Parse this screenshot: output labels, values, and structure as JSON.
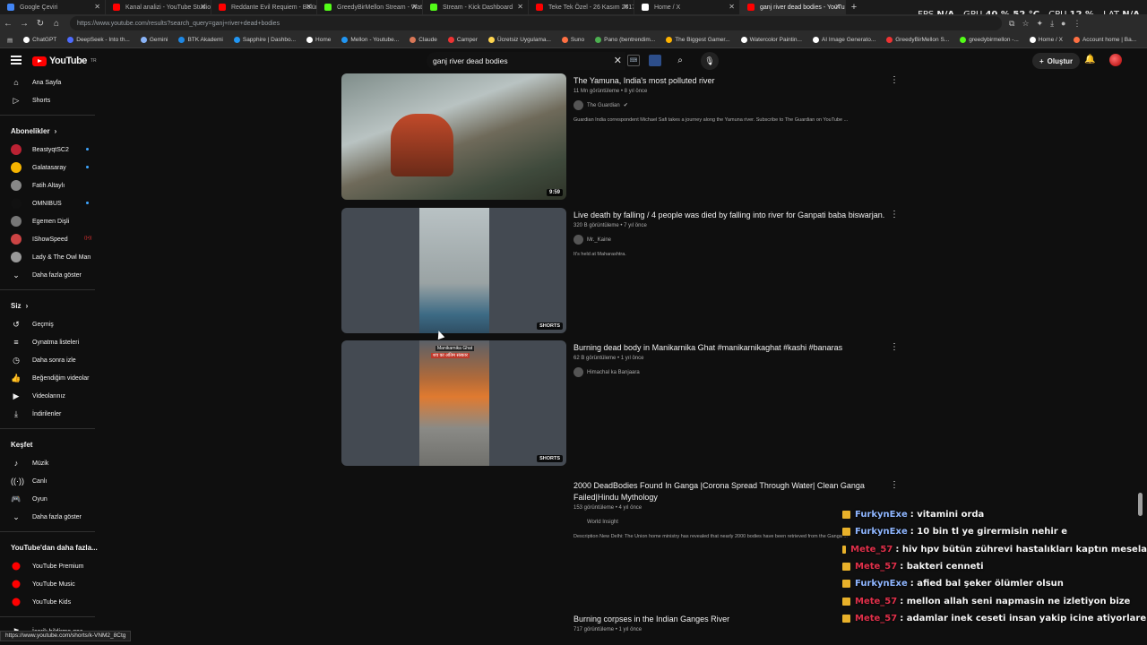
{
  "browser": {
    "tabs": [
      {
        "label": "Google Çeviri",
        "color": "#4285f4",
        "active": false
      },
      {
        "label": "Kanal analizi - YouTube Studio",
        "color": "#ff0000",
        "active": false
      },
      {
        "label": "Reddante Evil Requiem - Bölüm 4",
        "color": "#ff0000",
        "active": false
      },
      {
        "label": "GreedyBirMellon Stream - Watch",
        "color": "#53fc18",
        "active": false
      },
      {
        "label": "Stream - Kick Dashboard",
        "color": "#53fc18",
        "active": false
      },
      {
        "label": "Teke Tek Özel - 26 Kasım 2017 \"Cu",
        "color": "#ff0000",
        "active": false
      },
      {
        "label": "Home / X",
        "color": "#ffffff",
        "active": false
      },
      {
        "label": "ganj river dead bodies - YouTube",
        "color": "#ff0000",
        "active": true
      }
    ],
    "new_tab": "+",
    "perf": {
      "fps_label": "FPS",
      "fps": "N/A",
      "gpu_label": "GPU",
      "gpu": "40 % 52 °C",
      "cpu_label": "CPU",
      "cpu": "12 %",
      "lat_label": "LAT",
      "lat": "N/A"
    },
    "url": "https://www.youtube.com/results?search_query=ganj+river+dead+bodies",
    "bookmarks": [
      {
        "label": "ChatGPT",
        "color": "#ffffff"
      },
      {
        "label": "DeepSeek - Into th...",
        "color": "#4d6bfe"
      },
      {
        "label": "Gemini",
        "color": "#8ab4f8"
      },
      {
        "label": "BTK Akademi",
        "color": "#1e88e5"
      },
      {
        "label": "Sapphire | Dashbo...",
        "color": "#2196f3"
      },
      {
        "label": "Home",
        "color": "#ffffff"
      },
      {
        "label": "Mellon - Youtube...",
        "color": "#2196f3"
      },
      {
        "label": "Claude",
        "color": "#d97757"
      },
      {
        "label": "Camper",
        "color": "#e33"
      },
      {
        "label": "Ücretsiz Uygulama...",
        "color": "#ffd54f"
      },
      {
        "label": "Suno",
        "color": "#ff7043"
      },
      {
        "label": "Pano (bentrendim...",
        "color": "#4caf50"
      },
      {
        "label": "The Biggest Gamer...",
        "color": "#ffb300"
      },
      {
        "label": "Watercolor Paintin...",
        "color": "#ffffff"
      },
      {
        "label": "AI Image Generato...",
        "color": "#ffffff"
      },
      {
        "label": "GreedyBirMellon S...",
        "color": "#e33"
      },
      {
        "label": "greedybirmellon -...",
        "color": "#53fc18"
      },
      {
        "label": "Home / X",
        "color": "#ffffff"
      },
      {
        "label": "Account home | Ba...",
        "color": "#ff7043"
      }
    ],
    "status_url": "https://www.youtube.com/shorts/k-VNM2_8Ctg"
  },
  "youtube": {
    "logo_text": "YouTube",
    "logo_sup": "TR",
    "search_value": "ganj river dead bodies",
    "create_label": "Oluştur",
    "sidebar": {
      "main": [
        {
          "label": "Ana Sayfa",
          "icon": "home-icon"
        },
        {
          "label": "Shorts",
          "icon": "shorts-icon"
        }
      ],
      "subs_header": "Abonelikler",
      "subs": [
        {
          "label": "BeastyqtSC2",
          "color": "#b23",
          "live": true
        },
        {
          "label": "Galatasaray",
          "color": "#f6b400",
          "live": true
        },
        {
          "label": "Fatih Altaylı",
          "color": "#888",
          "live": false
        },
        {
          "label": "OMNIBUS",
          "color": "#111",
          "live": true
        },
        {
          "label": "Egemen Dişli",
          "color": "#777",
          "live": false
        },
        {
          "label": "IShowSpeed",
          "color": "#c44",
          "live": false,
          "tag": "((•))"
        },
        {
          "label": "Lady & The Owl Man",
          "color": "#999",
          "live": false
        }
      ],
      "subs_more": "Daha fazla göster",
      "you_header": "Siz",
      "you": [
        {
          "label": "Geçmiş",
          "icon": "history-icon"
        },
        {
          "label": "Oynatma listeleri",
          "icon": "playlist-icon"
        },
        {
          "label": "Daha sonra izle",
          "icon": "clock-icon"
        },
        {
          "label": "Beğendiğim videolar",
          "icon": "like-icon"
        },
        {
          "label": "Videolarınız",
          "icon": "video-icon"
        },
        {
          "label": "İndirilenler",
          "icon": "download-icon"
        }
      ],
      "explore_header": "Keşfet",
      "explore": [
        {
          "label": "Müzik",
          "icon": "music-icon"
        },
        {
          "label": "Canlı",
          "icon": "live-icon"
        },
        {
          "label": "Oyun",
          "icon": "gaming-icon"
        },
        {
          "label": "Daha fazla göster",
          "icon": "chevron-down-icon"
        }
      ],
      "more_header": "YouTube'dan daha fazla...",
      "more": [
        {
          "label": "YouTube Premium"
        },
        {
          "label": "YouTube Music"
        },
        {
          "label": "YouTube Kids"
        }
      ],
      "report": "İçerik bildirme geç..."
    },
    "results": [
      {
        "title": "The Yamuna, India's most polluted river",
        "meta": "11 Mn görüntüleme • 8 yıl önce",
        "channel": "The Guardian",
        "verified": true,
        "desc": "Guardian India correspondent Michael Safi takes a journey along the Yamuna river. Subscribe to The Guardian on YouTube ...",
        "badge": "9:59"
      },
      {
        "title": "Live death by falling / 4 people was died by falling into river for Ganpati baba biswarjan.",
        "meta": "320 B görüntüleme • 7 yıl önce",
        "channel": "Mr._Kaine",
        "desc": "It's held at Maharashtra.",
        "badge": "SHORTS"
      },
      {
        "title": "Burning dead body in Manikarnika Ghat #manikarnikaghat #kashi #banaras",
        "meta": "62 B görüntüleme • 1 yıl önce",
        "channel": "Himachal ka Banjaara",
        "desc": "",
        "badge": "SHORTS",
        "thumb_caption_1": "Manikarnika Ghat",
        "thumb_caption_2": "शव का अंतिम संस्कार"
      },
      {
        "title": "2000 DeadBodies Found In Ganga |Corona Spread Through Water| Clean Ganga Failed|Hindu Mythology",
        "meta": "153 görüntüleme • 4 yıl önce",
        "channel": "World Insight",
        "desc": "Description New Delhi: The Union home ministry has revealed that nearly 2000 bodies have been retrieved from the Ganga ..."
      },
      {
        "title": "Burning corpses in the Indian Ganges River",
        "meta": "717 görüntüleme • 1 yıl önce"
      }
    ]
  },
  "chat": [
    {
      "user": "FurkynExe",
      "color": "#8fb6ff",
      "text": ": vitamini orda"
    },
    {
      "user": "FurkynExe",
      "color": "#8fb6ff",
      "text": ": 10 bin tl ye girermisin nehir e"
    },
    {
      "user": "Mete_57",
      "color": "#e0304a",
      "text": ": hiv hpv bütün zührevi hastalıkları kaptın mesela"
    },
    {
      "user": "Mete_57",
      "color": "#e0304a",
      "text": ": bakteri cenneti"
    },
    {
      "user": "FurkynExe",
      "color": "#8fb6ff",
      "text": ": afied bal şeker ölümler olsun"
    },
    {
      "user": "Mete_57",
      "color": "#e0304a",
      "text": ": mellon allah seni napmasin ne izletiyon bize"
    },
    {
      "user": "Mete_57",
      "color": "#e0304a",
      "text": ": adamlar inek ceseti insan yakip icine atiyorlare"
    }
  ]
}
